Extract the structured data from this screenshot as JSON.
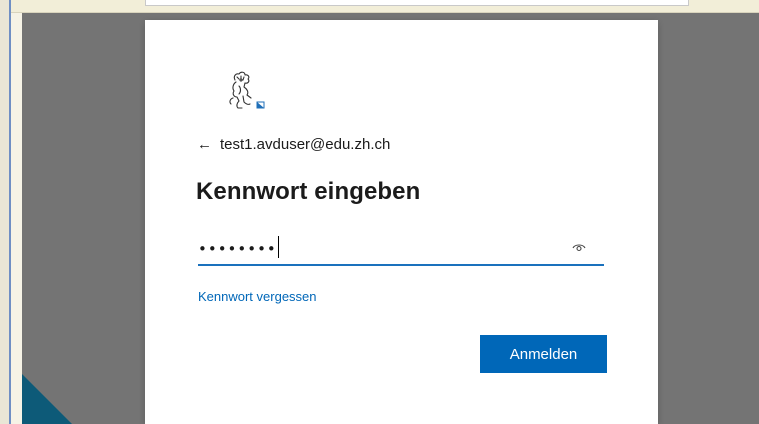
{
  "login": {
    "account_email": "test1.avduser@edu.zh.ch",
    "back_glyph": "←",
    "title": "Kennwort eingeben",
    "password_masked": "••••••••",
    "forgot_password_label": "Kennwort vergessen",
    "submit_label": "Anmelden"
  },
  "icons": {
    "back": "back-arrow-icon",
    "logo": "zurich-lion-logo",
    "reveal": "eye-icon"
  },
  "colors": {
    "accent": "#0067b8",
    "input_underline": "#1a71bd",
    "backdrop": "#747474",
    "card": "#ffffff"
  }
}
